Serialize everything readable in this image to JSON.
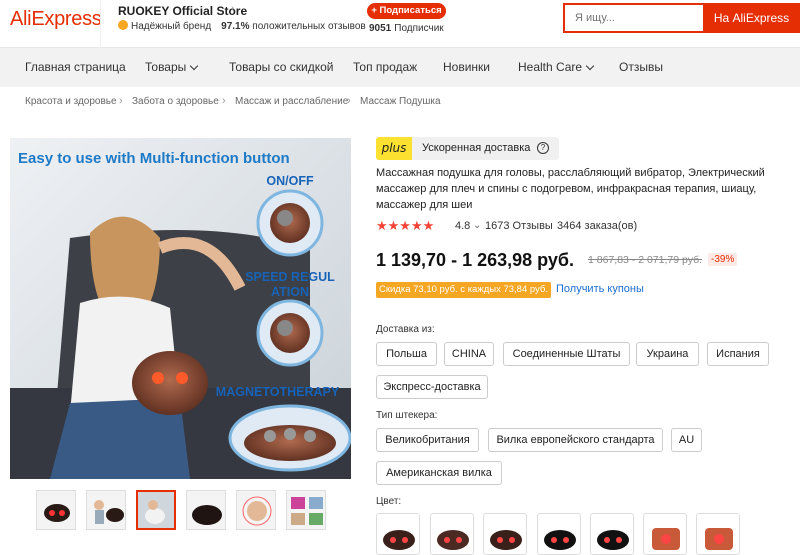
{
  "header": {
    "logo": "AliExpress",
    "store_name": "RUOKEY Official Store",
    "store_chevron": "›",
    "trusted_label": "Надёжный бренд",
    "positive_pct": "97.1%",
    "positive_label": "положительных отзывов",
    "subscribe_label": "+ Подписаться",
    "subscribers_count": "9051",
    "subscribers_label": "Подписчик",
    "search_placeholder": "Я ищу...",
    "search_button": "На AliExpress",
    "accent_color": "#e62e04"
  },
  "nav": {
    "items": [
      "Главная страница",
      "Товары",
      "Товары со скидкой",
      "Топ продаж",
      "Новинки",
      "Health Care",
      "Отзывы"
    ]
  },
  "breadcrumb": [
    "Красота и здоровье",
    "Забота о здоровье",
    "Массаж и расслабление",
    "Массаж Подушка"
  ],
  "breadcrumb_separator": "›",
  "gallery": {
    "headline": "Easy to use with Multi-function button",
    "labels": [
      "ON/OFF",
      "SPEED REGUL ATION",
      "MAGNETOTHERAPY"
    ],
    "thumbnail_count": 6,
    "active_thumbnail": 3
  },
  "product": {
    "plus_badge": "plus",
    "plus_text": "Ускоренная доставка",
    "help_icon": "?",
    "title": "Массажная подушка для головы, расслабляющий вибратор, Электрический массажер для плеч и спины с подогревом, инфракрасная терапия, шиацу, массажер для шеи",
    "stars": "★★★★★",
    "rating": "4.8",
    "rating_chevron": "⌄",
    "reviews": "1673 Отзывы",
    "orders": "3464 заказа(ов)",
    "price": "1 139,70 - 1 263,98 руб.",
    "old_price": "1 867,83 - 2 071,79 руб.",
    "discount": "-39%",
    "coupon": "Скидка 73,10 руб. с каждых 73,84 руб.",
    "coupon_link": "Получить купоны",
    "ship_from_label": "Доставка из:",
    "ship_from": [
      "Польша",
      "CHINA",
      "Соединенные Штаты",
      "Украина",
      "Испания",
      "Экспресс-доставка"
    ],
    "plug_label": "Тип штекера:",
    "plug_types": [
      "Великобритания",
      "Вилка европейского стандарта",
      "AU",
      "Американская вилка"
    ],
    "color_label": "Цвет:",
    "color_count": 7
  }
}
